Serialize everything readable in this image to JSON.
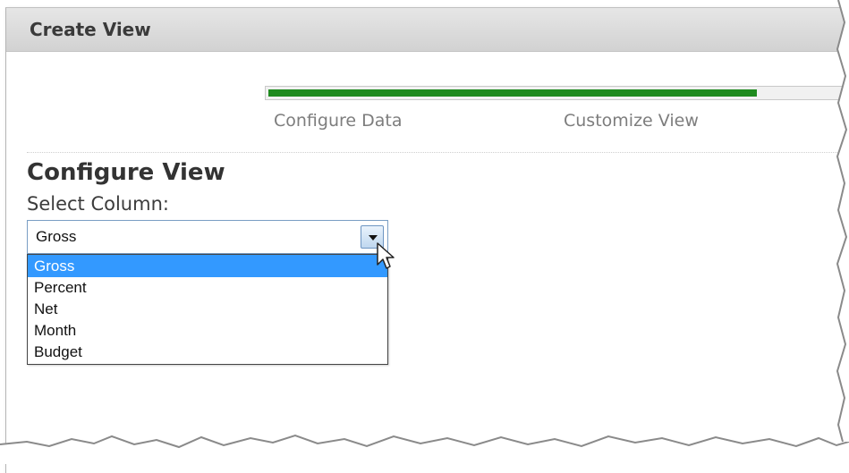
{
  "window": {
    "title": "Create View"
  },
  "wizard": {
    "progress_fraction": 0.85,
    "steps": [
      {
        "label": "Configure Data"
      },
      {
        "label": "Customize View"
      }
    ]
  },
  "section": {
    "heading": "Configure View",
    "field_label": "Select Column:"
  },
  "select": {
    "value": "Gross",
    "options": [
      "Gross",
      "Percent",
      "Net",
      "Month",
      "Budget"
    ],
    "highlighted_index": 0
  },
  "colors": {
    "progress_fill": "#1e8a1e",
    "highlight": "#3399ff",
    "titlebar": "#dcdcdc"
  },
  "icons": {
    "dropdown": "chevron-down-icon",
    "cursor": "mouse-pointer-icon"
  }
}
